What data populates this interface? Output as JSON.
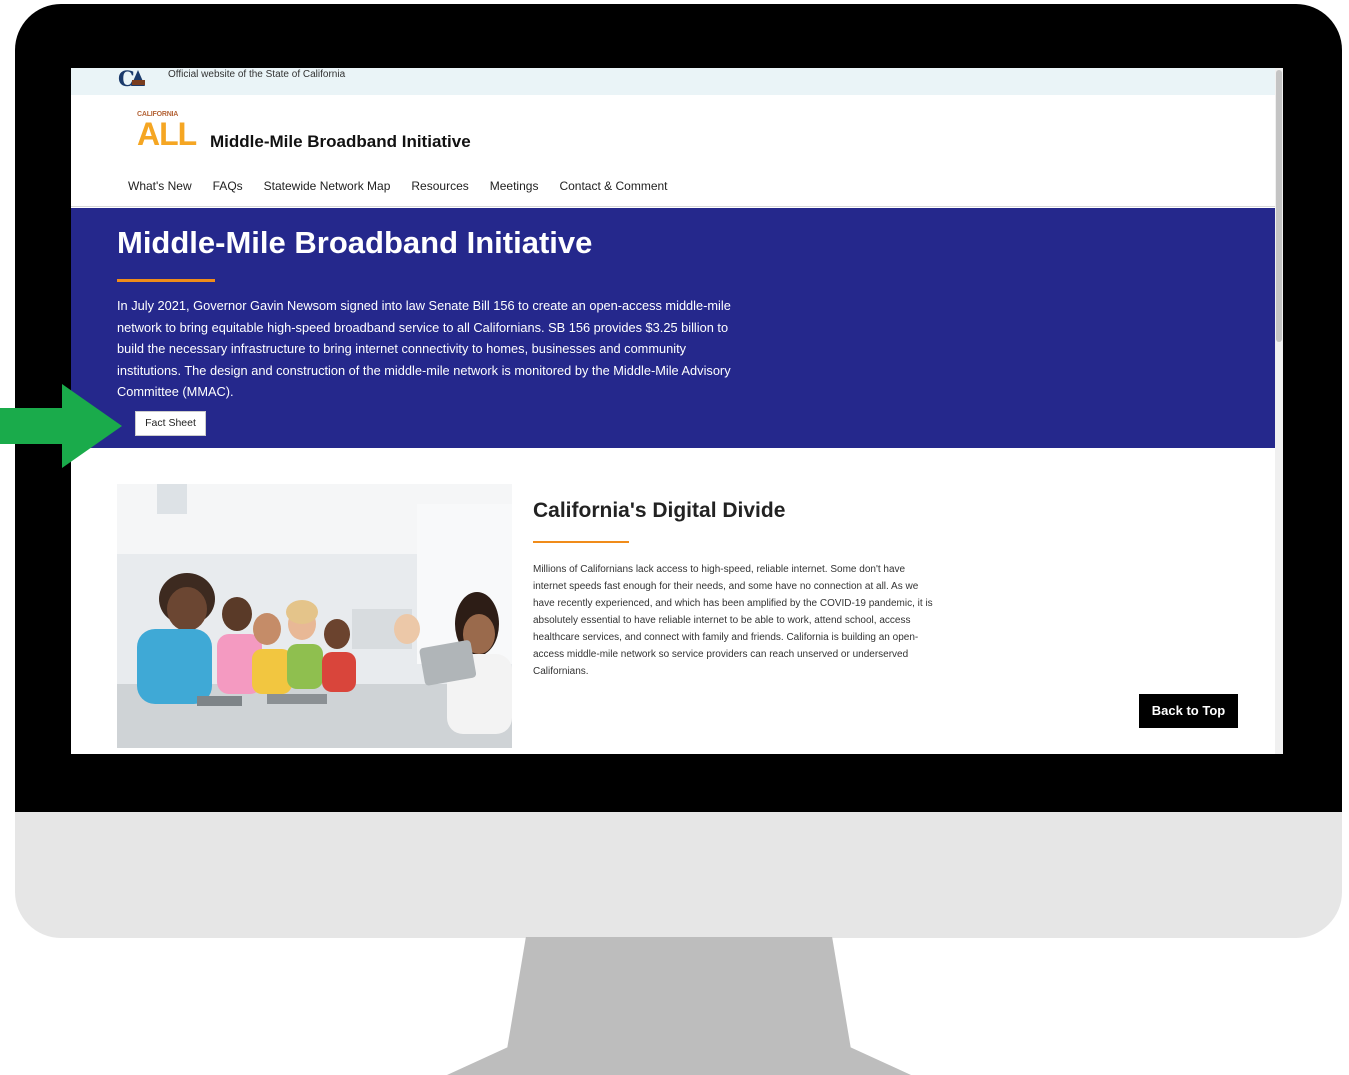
{
  "gov_bar": {
    "text": "Official website of the State of California",
    "logo_icon": "california-state-logo-icon"
  },
  "brand": {
    "small": "CALIFORNIA",
    "big": "ALL",
    "site_title": "Middle-Mile Broadband Initiative"
  },
  "nav": {
    "items": [
      {
        "label": "What's New"
      },
      {
        "label": "FAQs"
      },
      {
        "label": "Statewide Network Map"
      },
      {
        "label": "Resources"
      },
      {
        "label": "Meetings"
      },
      {
        "label": "Contact & Comment"
      }
    ]
  },
  "hero": {
    "title": "Middle-Mile Broadband Initiative",
    "body": "In July 2021, Governor Gavin Newsom signed into law Senate Bill 156 to create an open-access middle-mile network to bring equitable high-speed broadband service to all Californians. SB 156 provides $3.25 billion to build the necessary infrastructure to bring internet connectivity to homes, businesses and community institutions. The design and construction of the middle-mile network is monitored by the Middle-Mile Advisory Committee (MMAC).",
    "button_label": "Fact Sheet",
    "background_color": "#25288c",
    "accent_color": "#f08c1a"
  },
  "section": {
    "title": "California's Digital Divide",
    "body": "Millions of Californians lack access to high-speed, reliable internet. Some don't have internet speeds fast enough for their needs, and some have no connection at all. As we have recently experienced, and which has been amplified by the COVID-19 pandemic, it is absolutely essential to have reliable internet to be able to work, attend school, access healthcare services, and connect with family and friends. California is building an open-access middle-mile network so service providers can reach unserved or underserved Californians."
  },
  "back_to_top": {
    "label": "Back to Top"
  },
  "annotation": {
    "arrow_icon": "green-arrow-icon",
    "arrow_color": "#1aab4b"
  }
}
